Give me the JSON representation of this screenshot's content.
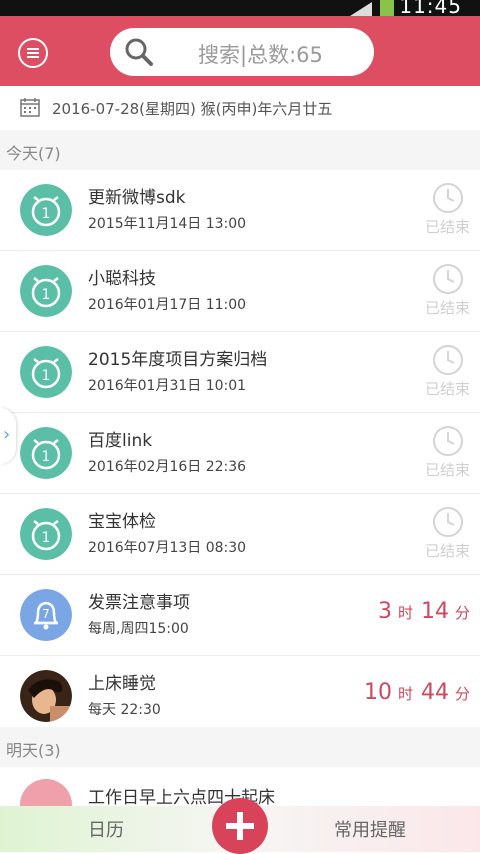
{
  "status_bar": {
    "time": "11:45"
  },
  "header": {
    "search_placeholder": "搜索|总数:65"
  },
  "date_bar": {
    "date_text": "2016-07-28(星期四)   猴(丙申)年六月廿五"
  },
  "sections": {
    "today": "今天(7)",
    "tomorrow": "明天(3)"
  },
  "items": [
    {
      "title": "更新微博sdk",
      "subtitle": "2015年11月14日 13:00",
      "status": "已结束",
      "icon": "alarm-clock-icon"
    },
    {
      "title": "小聪科技",
      "subtitle": "2016年01月17日 11:00",
      "status": "已结束",
      "icon": "alarm-clock-icon"
    },
    {
      "title": "2015年度项目方案归档",
      "subtitle": "2016年01月31日 10:01",
      "status": "已结束",
      "icon": "alarm-clock-icon"
    },
    {
      "title": "百度link",
      "subtitle": "2016年02月16日 22:36",
      "status": "已结束",
      "icon": "alarm-clock-icon"
    },
    {
      "title": "宝宝体检",
      "subtitle": "2016年07月13日 08:30",
      "status": "已结束",
      "icon": "alarm-clock-icon"
    },
    {
      "title": "发票注意事项",
      "subtitle": "每周,周四15:00",
      "hours": "3",
      "hours_unit": "时",
      "minutes": "14",
      "minutes_unit": "分",
      "icon": "bell-icon"
    },
    {
      "title": "上床睡觉",
      "subtitle": "每天 22:30",
      "hours": "10",
      "hours_unit": "时",
      "minutes": "44",
      "minutes_unit": "分",
      "icon": "photo-avatar"
    }
  ],
  "tomorrow_items": [
    {
      "title": "工作日早上六点四十起床"
    }
  ],
  "bottom_nav": {
    "calendar": "日历",
    "reminders": "常用提醒"
  },
  "colors": {
    "header": "#dd4e62",
    "teal": "#5bbfa8",
    "accent": "#d1475c",
    "bell_blue": "#7aa6e6"
  }
}
